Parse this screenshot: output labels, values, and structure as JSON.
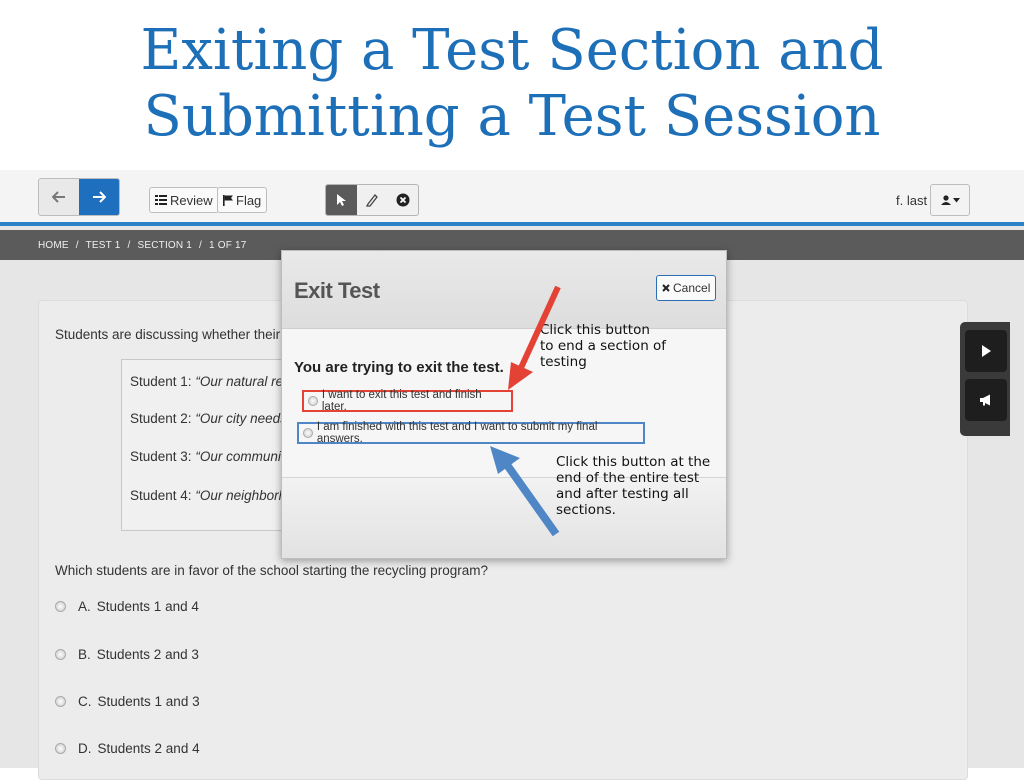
{
  "slide": {
    "title_line1": "Exiting a Test Section and",
    "title_line2": "Submitting a Test Session"
  },
  "toolbar": {
    "back_icon": "arrow-left-icon",
    "next_icon": "arrow-right-icon",
    "review_label": "Review",
    "flag_label": "Flag",
    "tools": [
      "pointer-icon",
      "highlighter-icon",
      "close-circle-icon"
    ],
    "user_name": "f. last",
    "accent_color": "#2a83c7"
  },
  "breadcrumb": [
    "HOME",
    "/",
    "TEST 1",
    "/",
    "SECTION 1",
    "/",
    "1 OF 17"
  ],
  "question": {
    "stem": "Students are discussing whether their sch",
    "quotes": [
      {
        "label": "Student 1:",
        "text": "“Our natural reso"
      },
      {
        "label": "Student 2:",
        "text": "“Our city needs to"
      },
      {
        "label": "Student 3:",
        "text": "“Our community"
      },
      {
        "label": "Student 4:",
        "text": "“Our neighborho"
      }
    ],
    "prompt": "Which students are in favor of the school starting the recycling program?",
    "answers": [
      {
        "letter": "A.",
        "text": "Students 1 and 4"
      },
      {
        "letter": "B.",
        "text": "Students 2 and 3"
      },
      {
        "letter": "C.",
        "text": "Students 1 and 3"
      },
      {
        "letter": "D.",
        "text": "Students 2 and 4"
      }
    ]
  },
  "modal": {
    "title": "Exit Test",
    "cancel_label": "Cancel",
    "heading": "You are trying to exit the test.",
    "option_later": "I want to exit this test and finish later.",
    "option_submit": "I am finished with this test and I want to submit my final answers."
  },
  "callouts": {
    "red_lines": [
      "Click this button",
      "to end a section of",
      "testing"
    ],
    "blue_lines": [
      "Click this button at the",
      "end of the entire test",
      "and after testing all",
      "sections."
    ],
    "red_color": "#e34234",
    "blue_color": "#4f86c6"
  }
}
